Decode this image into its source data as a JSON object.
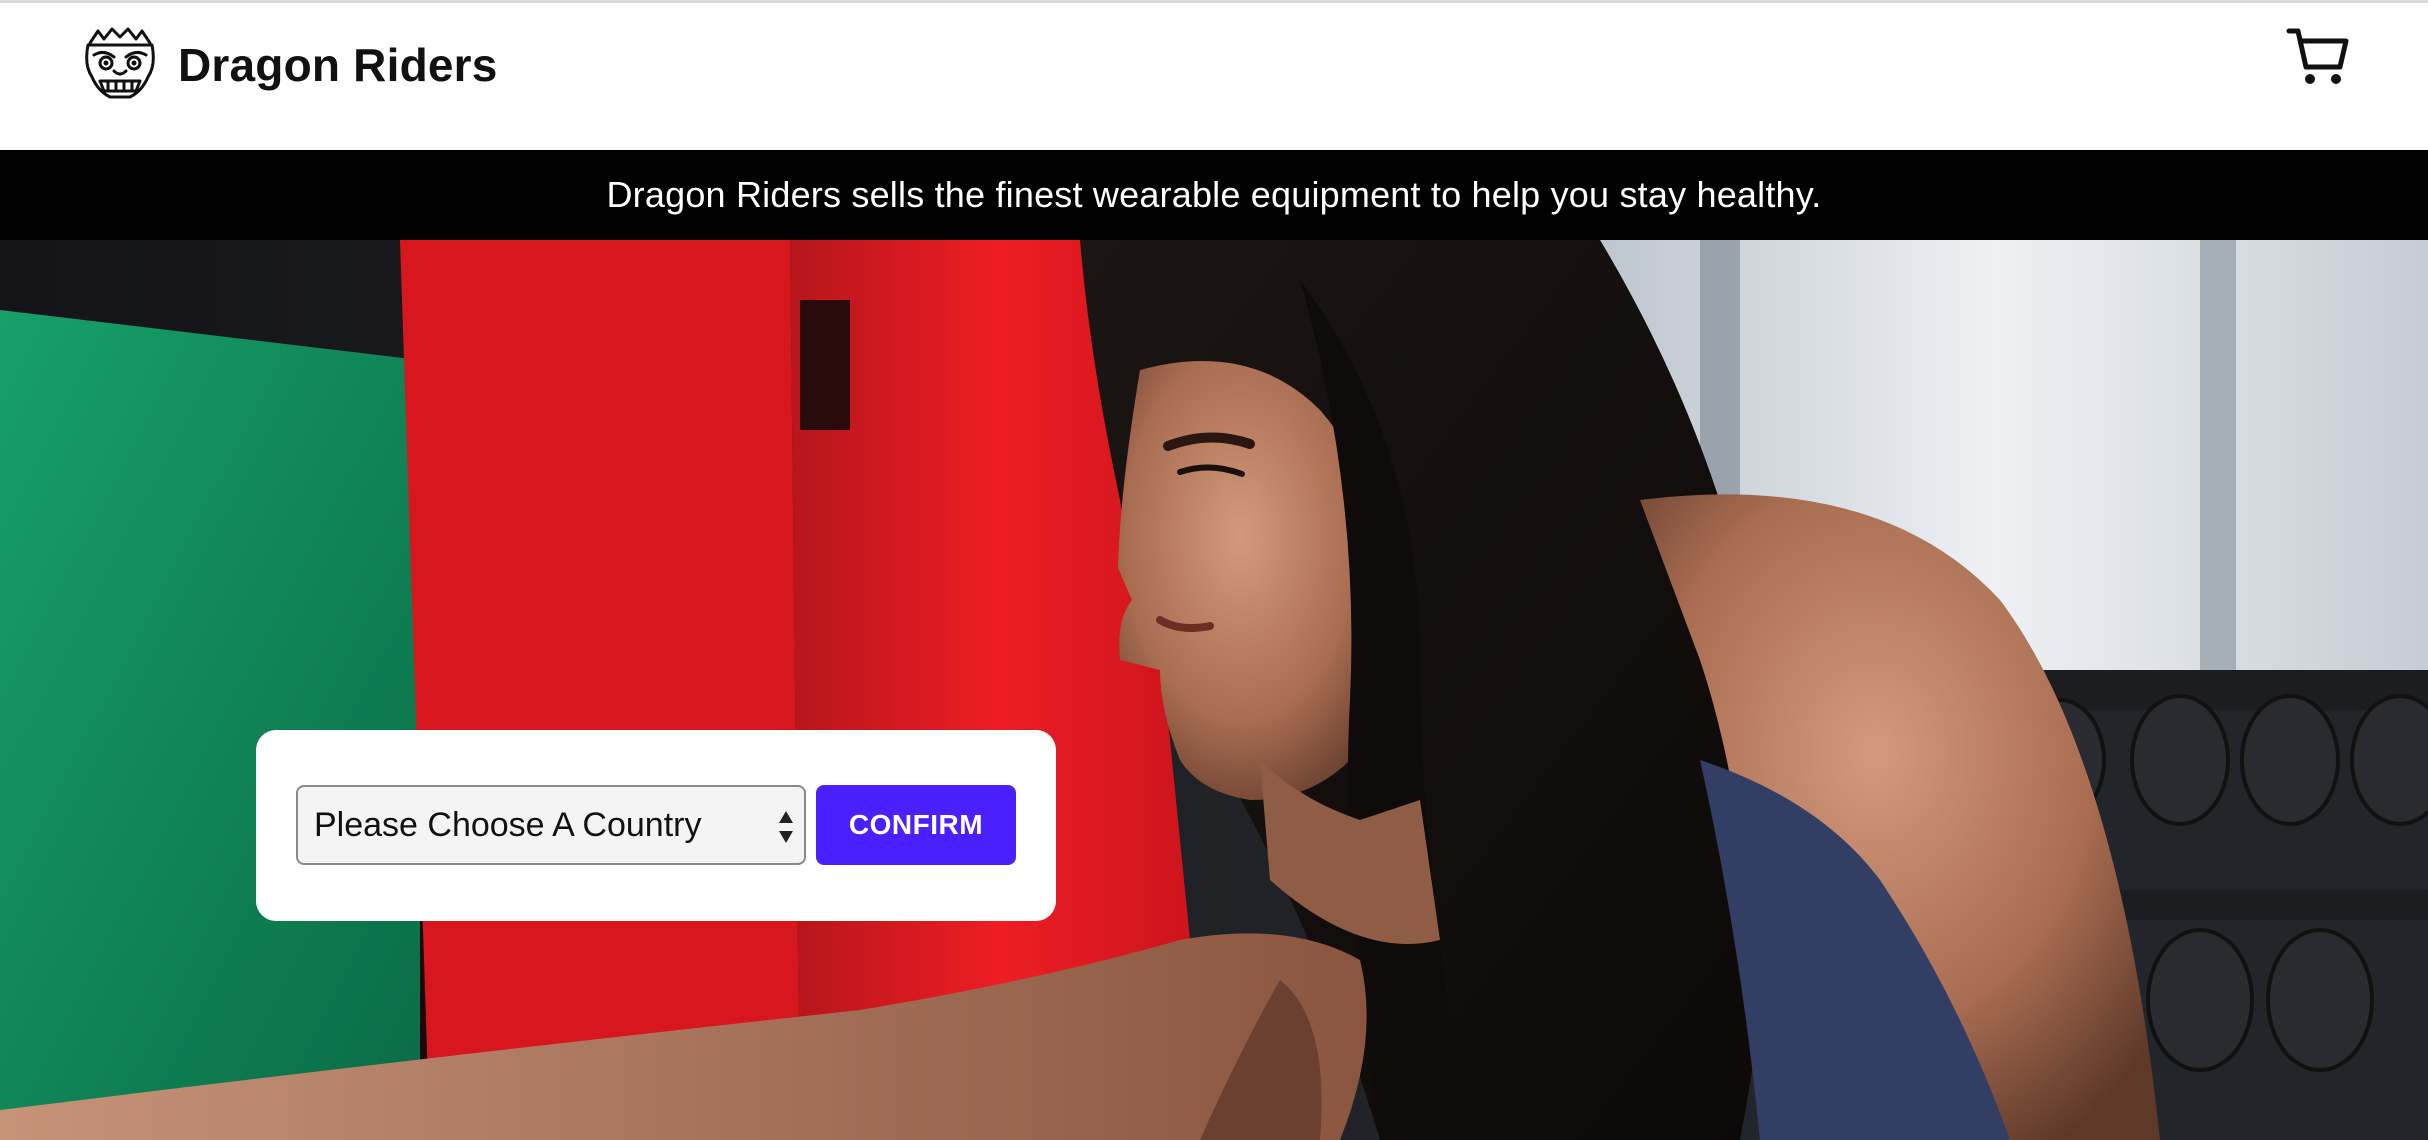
{
  "header": {
    "brand_name": "Dragon Riders",
    "logo_icon": "dragon-mask-icon",
    "cart_icon": "shopping-cart-icon"
  },
  "announcement": {
    "text": "Dragon Riders sells the finest wearable equipment to help you stay healthy."
  },
  "country_selector": {
    "selected_label": "Please Choose A Country",
    "confirm_label": "CONFIRM"
  },
  "colors": {
    "accent": "#4b20ff",
    "announcement_bg": "#000000",
    "header_bg": "#ffffff"
  }
}
